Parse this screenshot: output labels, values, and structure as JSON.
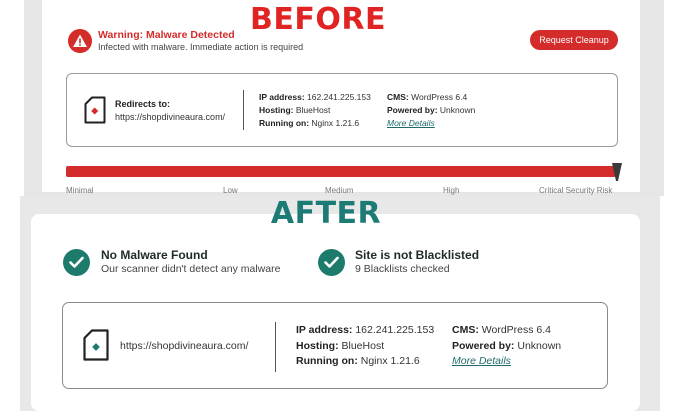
{
  "before": {
    "label": "BEFORE",
    "warning": {
      "title": "Warning: Malware Detected",
      "subtitle": "Infected with malware. Immediate action is required",
      "button": "Request Cleanup"
    },
    "info": {
      "redirects_label": "Redirects to:",
      "redirects_url": "https://shopdivineaura.com/",
      "ip_label": "IP address:",
      "ip_value": "162.241.225.153",
      "hosting_label": "Hosting:",
      "hosting_value": "BlueHost",
      "running_label": "Running on:",
      "running_value": "Nginx 1.21.6",
      "cms_label": "CMS:",
      "cms_value": "WordPress 6.4",
      "powered_label": "Powered by:",
      "powered_value": "Unknown",
      "more_details": "More Details"
    },
    "risk": {
      "level_fraction": 1.0,
      "bar_color": "#d42b2b",
      "labels": [
        "Minimal",
        "Low",
        "Medium",
        "High",
        "Critical Security Risk"
      ]
    }
  },
  "after": {
    "label": "AFTER",
    "status": [
      {
        "title": "No Malware Found",
        "subtitle": "Our scanner didn't detect any malware",
        "icon": "check-circle-icon"
      },
      {
        "title": "Site is not Blacklisted",
        "subtitle": "9 Blacklists checked",
        "icon": "check-circle-icon"
      }
    ],
    "info": {
      "url": "https://shopdivineaura.com/",
      "ip_label": "IP address:",
      "ip_value": "162.241.225.153",
      "hosting_label": "Hosting:",
      "hosting_value": "BlueHost",
      "running_label": "Running on:",
      "running_value": "Nginx 1.21.6",
      "cms_label": "CMS:",
      "cms_value": "WordPress 6.4",
      "powered_label": "Powered by:",
      "powered_value": "Unknown",
      "more_details": "More Details"
    }
  },
  "colors": {
    "danger": "#d42b2b",
    "success": "#1d7b6b",
    "after_heading": "#1d7b76"
  }
}
